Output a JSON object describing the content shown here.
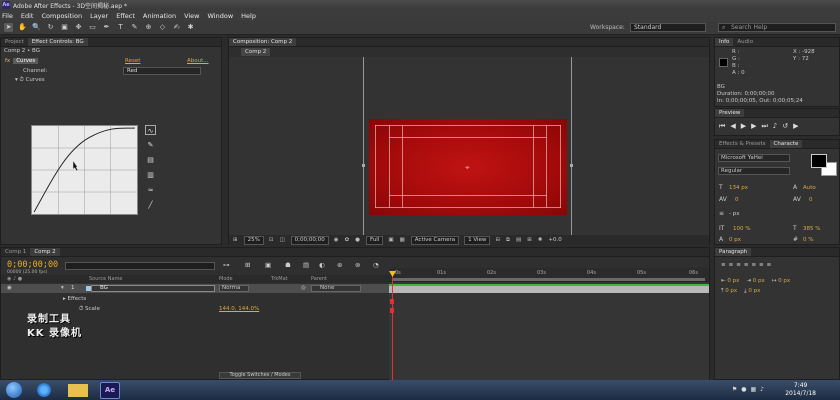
{
  "window": {
    "title": "Adobe After Effects - 3D空间揭秘.aep *"
  },
  "menu": [
    "File",
    "Edit",
    "Composition",
    "Layer",
    "Effect",
    "Animation",
    "View",
    "Window",
    "Help"
  ],
  "workspace": {
    "label": "Workspace:",
    "value": "Standard"
  },
  "search": {
    "placeholder": "Search Help"
  },
  "effect_panel": {
    "tabs": [
      "Project",
      "Effect Controls: BG"
    ],
    "breadcrumb": "Comp 2 • BG",
    "effect_name": "Curves",
    "reset": "Reset",
    "about": "About...",
    "channel_label": "Channel:",
    "channel_value": "Red",
    "curves_label": "Curves"
  },
  "comp_panel": {
    "tab": "Composition: Comp 2",
    "subtab": "Comp 2",
    "zoom": "25%",
    "timecode": "0;00;00;00",
    "resolution": "Full",
    "camera": "Active Camera",
    "view": "1 View",
    "exposure": "+0.0"
  },
  "info_panel": {
    "tabs": [
      "Info",
      "Audio"
    ],
    "r": "R :",
    "g": "G :",
    "b": "B :",
    "a": "A : 0",
    "x": "X : -928",
    "y": "Y : 72",
    "layer": "BG",
    "duration": "Duration: 0;00;00;00",
    "inout": "In: 0;00;00;05, Out: 0;00;05;24"
  },
  "preview_panel": {
    "tab": "Preview"
  },
  "char_panel": {
    "tabs": [
      "Effects & Presets",
      "Characte"
    ],
    "font": "Microsoft YaHei",
    "style": "Regular",
    "size": "134 px",
    "leading": "Auto",
    "kerning": "0",
    "tracking": "0",
    "stroke": "- px",
    "vscale": "100 %",
    "hscale": "385 %",
    "baseline": "0 px",
    "tsume": "0 %"
  },
  "timeline": {
    "tabs": [
      "Comp 1",
      "Comp 2"
    ],
    "time": "0;00;00;00",
    "fps": "00000 (25.00 fps)",
    "columns": {
      "source": "Source Name",
      "mode": "Mode",
      "trkmat": "TrkMat",
      "parent": "Parent"
    },
    "layer": {
      "num": "1",
      "name": "BG",
      "mode": "Norma",
      "parent": "None"
    },
    "effects": "Effects",
    "scale_label": "Scale",
    "scale_value": "144.0, 144.0%",
    "ruler": [
      "0s",
      "01s",
      "02s",
      "03s",
      "04s",
      "05s",
      "06s"
    ],
    "toggle": "Toggle Switches / Modes"
  },
  "watermark": {
    "line1": "录制工具",
    "line2": "KK 录像机"
  },
  "paragraph_panel": {
    "tab": "Paragraph",
    "indent1": "0 px",
    "indent2": "0 px",
    "indent3": "0 px",
    "space1": "0 px",
    "space2": "0 px"
  },
  "taskbar": {
    "app": "Ae",
    "time": "7:49",
    "date": "2014/7/18"
  }
}
